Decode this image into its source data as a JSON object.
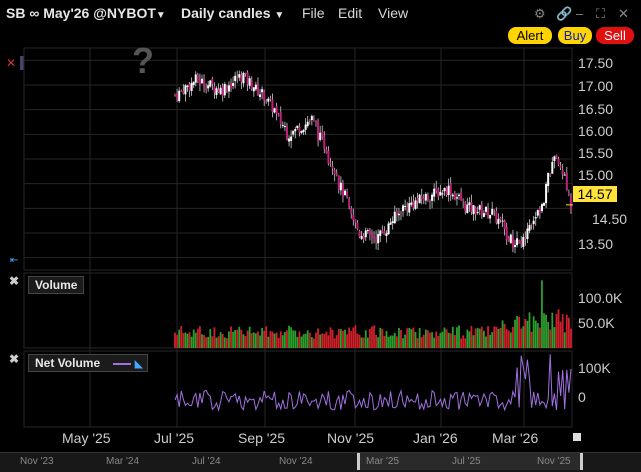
{
  "window": {
    "symbol": "SB ∞ May'26 @NYBOT",
    "chart_mode": "Daily candles",
    "menu": [
      "File",
      "Edit",
      "View"
    ]
  },
  "buttons": {
    "alert": "Alert",
    "buy": "Buy",
    "sell": "Sell"
  },
  "colors": {
    "alert_bg": "#ffd400",
    "buy_bg": "#ffd400",
    "sell_bg": "#e01010",
    "candle_up": "#ffffff",
    "candle_down": "#c0207a",
    "volume_up": "#2ca02c",
    "volume_down": "#d0202a",
    "net_volume": "#a070e0",
    "last_price_bg": "#ffe23a"
  },
  "price_panel": {
    "y_ticks": [
      "17.50",
      "17.00",
      "16.50",
      "16.00",
      "15.50",
      "15.00",
      "14.50",
      "13.50"
    ],
    "last_price": "14.57",
    "placeholder_glyph": "?"
  },
  "volume_panel": {
    "label": "Volume",
    "y_ticks": [
      "100.0K",
      "50.0K"
    ]
  },
  "net_volume_panel": {
    "label": "Net Volume",
    "y_ticks": [
      "100K",
      "0"
    ]
  },
  "x_axis": {
    "labels": [
      "May '25",
      "Jul '25",
      "Sep '25",
      "Nov '25",
      "Jan '26",
      "Mar '26"
    ]
  },
  "navigator": {
    "labels": [
      "Nov '23",
      "Mar '24",
      "Jul '24",
      "Nov '24",
      "Mar '25",
      "Jul '25",
      "Nov '25"
    ]
  },
  "chart_data": {
    "type": "candlestick",
    "price_range": [
      13.25,
      17.75
    ],
    "series_close_anchor": [
      {
        "date": "2025-07-01",
        "close": 16.8
      },
      {
        "date": "2025-07-15",
        "close": 17.1
      },
      {
        "date": "2025-08-01",
        "close": 16.9
      },
      {
        "date": "2025-08-15",
        "close": 17.2
      },
      {
        "date": "2025-09-01",
        "close": 16.7
      },
      {
        "date": "2025-09-15",
        "close": 16.0
      },
      {
        "date": "2025-10-01",
        "close": 16.3
      },
      {
        "date": "2025-10-15",
        "close": 15.4
      },
      {
        "date": "2025-11-01",
        "close": 14.0
      },
      {
        "date": "2025-11-15",
        "close": 13.9
      },
      {
        "date": "2025-12-01",
        "close": 14.5
      },
      {
        "date": "2025-12-15",
        "close": 14.7
      },
      {
        "date": "2026-01-01",
        "close": 14.9
      },
      {
        "date": "2026-01-15",
        "close": 14.5
      },
      {
        "date": "2026-02-01",
        "close": 14.4
      },
      {
        "date": "2026-02-15",
        "close": 13.7
      },
      {
        "date": "2026-03-01",
        "close": 14.2
      },
      {
        "date": "2026-03-15",
        "close": 15.7
      },
      {
        "date": "2026-03-25",
        "close": 14.57
      }
    ],
    "volume_range": [
      0,
      140000
    ],
    "net_volume_range": [
      -60000,
      130000
    ]
  }
}
